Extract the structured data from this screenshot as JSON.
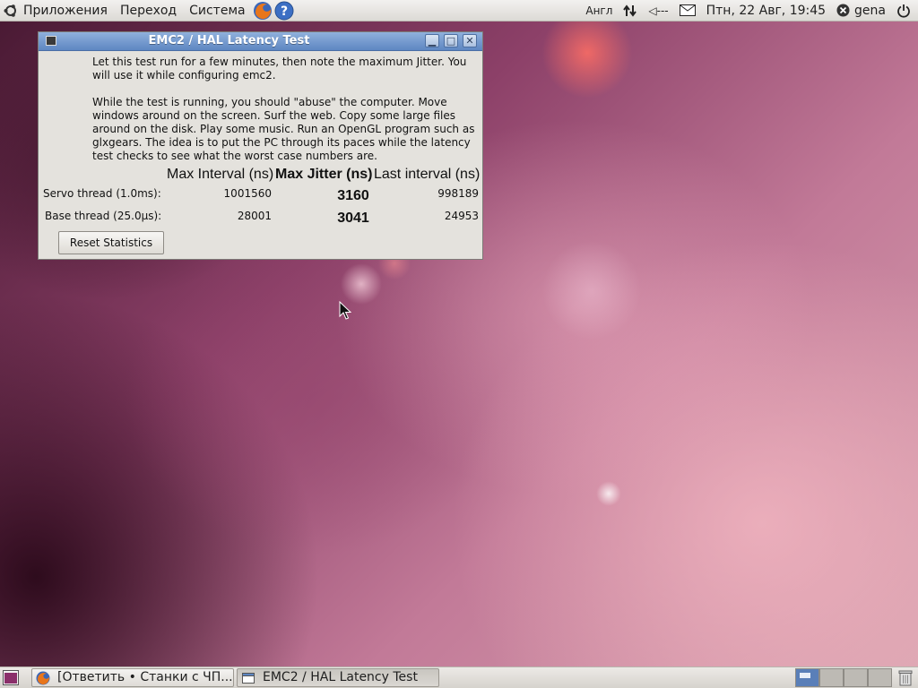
{
  "top_panel": {
    "menus": [
      "Приложения",
      "Переход",
      "Система"
    ],
    "keyboard_layout": "Англ",
    "volume_text": "◁---",
    "datetime": "Птн, 22 Авг, 19:45",
    "user": "gena"
  },
  "window": {
    "title": "EMC2 / HAL Latency Test",
    "paragraph1": "Let this test run for a few minutes, then note the maximum Jitter.  You will use it while configuring emc2.",
    "paragraph2": "While the test is running, you should \"abuse\" the computer. Move windows around on the screen. Surf the web. Copy some large files around on the disk. Play some music. Run an OpenGL program such as glxgears. The idea is to put the PC through its paces while the latency test checks to see what the worst case numbers are.",
    "headers": {
      "max_interval": "Max Interval (ns)",
      "max_jitter": "Max Jitter (ns)",
      "last_interval": "Last interval (ns)"
    },
    "rows": [
      {
        "label": "Servo thread (1.0ms):",
        "max_interval": "1001560",
        "max_jitter": "3160",
        "last_interval": "998189"
      },
      {
        "label": "Base thread (25.0µs):",
        "max_interval": "28001",
        "max_jitter": "3041",
        "last_interval": "24953"
      }
    ],
    "reset_button": "Reset Statistics"
  },
  "taskbar": {
    "tasks": [
      {
        "label": "[Ответить • Станки с ЧП...",
        "icon": "firefox-icon"
      },
      {
        "label": "EMC2 / HAL Latency Test",
        "icon": "window-icon"
      }
    ],
    "workspaces": 4,
    "active_workspace": 1
  },
  "colors": {
    "title_bar": "#5e87c2",
    "window_bg": "#e4e2dd",
    "panel_bg": "#dcdad5"
  }
}
